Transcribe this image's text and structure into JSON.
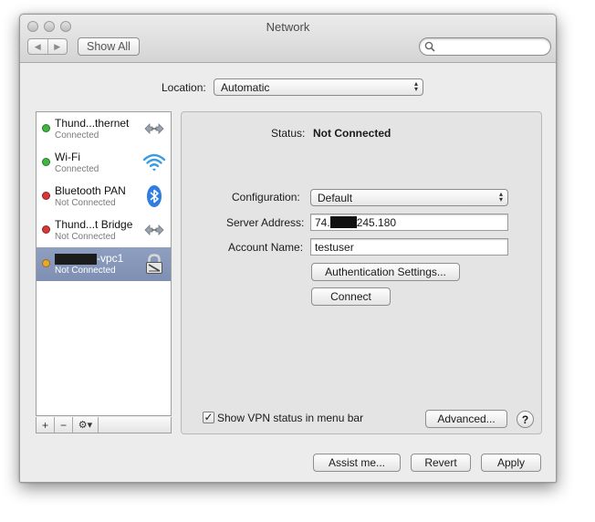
{
  "window": {
    "title": "Network"
  },
  "toolbar": {
    "back_label": "◀",
    "forward_label": "▶",
    "show_all_label": "Show All",
    "search_placeholder": ""
  },
  "location": {
    "label": "Location:",
    "value": "Automatic"
  },
  "services": [
    {
      "name": "Thund...thernet",
      "status": "Connected",
      "dot_color": "#3fb73f",
      "icon": "ethernet-arrows-icon"
    },
    {
      "name": "Wi-Fi",
      "status": "Connected",
      "dot_color": "#3fb73f",
      "icon": "wifi-icon"
    },
    {
      "name": "Bluetooth PAN",
      "status": "Not Connected",
      "dot_color": "#d93636",
      "icon": "bluetooth-icon"
    },
    {
      "name": "Thund...t Bridge",
      "status": "Not Connected",
      "dot_color": "#d93636",
      "icon": "bridge-arrows-icon"
    },
    {
      "name_suffix": "-vpc1",
      "status": "Not Connected",
      "dot_color": "#e8a92b",
      "icon": "vpn-lock-icon",
      "selected": true
    }
  ],
  "sidebar_tools": {
    "add": "+",
    "remove": "−",
    "action": "⚙▾"
  },
  "detail": {
    "status_label": "Status:",
    "status_value": "Not Connected",
    "configuration_label": "Configuration:",
    "configuration_value": "Default",
    "server_label": "Server Address:",
    "server_prefix": "74.",
    "server_suffix": "245.180",
    "account_label": "Account Name:",
    "account_value": "testuser",
    "auth_button": "Authentication Settings...",
    "connect_button": "Connect",
    "show_vpn_label": "Show VPN status in menu bar",
    "show_vpn_checked": true,
    "advanced_button": "Advanced...",
    "help_label": "?"
  },
  "footer": {
    "assist_label": "Assist me...",
    "revert_label": "Revert",
    "apply_label": "Apply"
  },
  "colors": {
    "selection": "#8797b9",
    "window_bg": "#ececec"
  }
}
